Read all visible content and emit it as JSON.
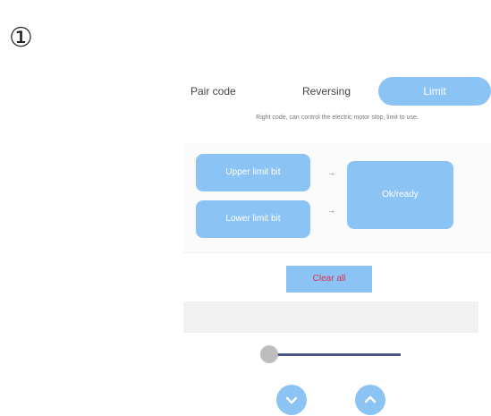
{
  "step_marker": "①",
  "tabs": [
    {
      "label": "Pair code",
      "active": false
    },
    {
      "label": "Reversing",
      "active": false
    },
    {
      "label": "Limit",
      "active": true
    }
  ],
  "hint_text": "Right code, can control the electric motor stop, limit to use.",
  "buttons": {
    "upper_limit": "Upper limit bit",
    "lower_limit": "Lower limit bit",
    "ok_ready": "Ok/ready",
    "clear_all": "Clear all"
  },
  "arrows": [
    "→",
    "→"
  ],
  "slider": {
    "value_fraction": 0.0
  },
  "controls": {
    "down_icon": "chevron-down-icon",
    "up_icon": "chevron-up-icon"
  },
  "colors": {
    "accent": "#8cc3f5",
    "danger_text": "#d9324a",
    "track": "#4b5487"
  }
}
